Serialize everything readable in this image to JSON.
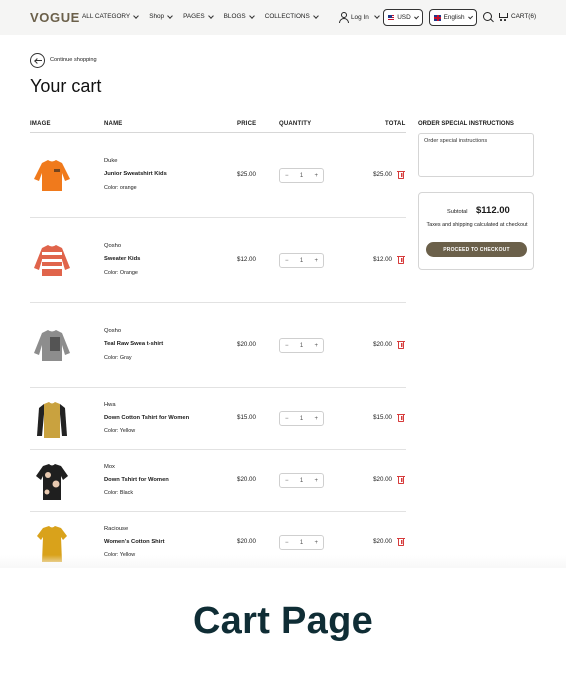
{
  "header": {
    "logo": "VOGUE",
    "nav": [
      "ALL CATEGORY",
      "Shop",
      "PAGES",
      "BLOGS",
      "COLLECTIONS"
    ],
    "login_label": "Log In",
    "currency": "USD",
    "language": "English",
    "cart_label": "CART(6)"
  },
  "continue_label": "Continue shopping",
  "page_title": "Your cart",
  "table": {
    "columns": {
      "image": "IMAGE",
      "name": "NAME",
      "price": "PRICE",
      "quantity": "QUANTITY",
      "total": "TOTAL"
    },
    "rows": [
      {
        "vendor": "Duke",
        "name": "Junior Sweatshirt Kids",
        "color": "Color: orange",
        "price": "$25.00",
        "qty": "1",
        "total": "$25.00",
        "swatch": "#f07a1c"
      },
      {
        "vendor": "Qosho",
        "name": "Sweater Kids",
        "color": "Color: Orange",
        "price": "$12.00",
        "qty": "1",
        "total": "$12.00",
        "swatch": "#e0644b"
      },
      {
        "vendor": "Qosho",
        "name": "Teal Raw Swea t-shirt",
        "color": "Color: Gray",
        "price": "$20.00",
        "qty": "1",
        "total": "$20.00",
        "swatch": "#8d8d8d"
      },
      {
        "vendor": "Hwa",
        "name": "Down Cotton Tshirt for Women",
        "color": "Color: Yellow",
        "price": "$15.00",
        "qty": "1",
        "total": "$15.00",
        "swatch": "#c9a23f"
      },
      {
        "vendor": "Mox",
        "name": "Down Tshirt for Women",
        "color": "Color: Black",
        "price": "$20.00",
        "qty": "1",
        "total": "$20.00",
        "swatch": "#1f1f1f"
      },
      {
        "vendor": "Raciouse",
        "name": "Women's Cotton Shirt",
        "color": "Color: Yellow",
        "price": "$20.00",
        "qty": "1",
        "total": "$20.00",
        "swatch": "#d9a21b"
      }
    ]
  },
  "sidebar": {
    "instructions_title": "ORDER SPECIAL INSTRUCTIONS",
    "instructions_placeholder": "Order special instructions",
    "subtotal_label": "Subtotal",
    "subtotal_value": "$112.00",
    "tax_note": "Taxes and shipping calculated at checkout",
    "checkout_label": "PROCEED TO CHECKOUT"
  },
  "banner_title": "Cart Page",
  "colors": {
    "brand": "#6b604a",
    "delete": "#d63b3b",
    "banner_text": "#0f2d35"
  }
}
